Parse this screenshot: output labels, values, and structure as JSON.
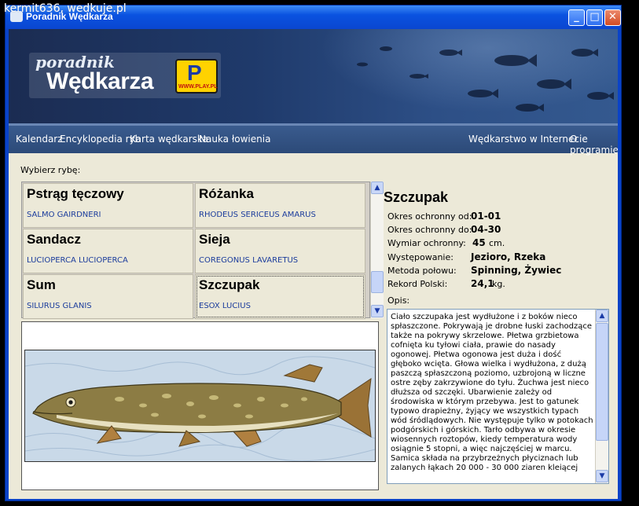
{
  "watermark": "kermit636, wedkuje.pl",
  "window": {
    "title": "Poradnik Wędkarza",
    "minimize": "_",
    "maximize": "□",
    "close": "✕"
  },
  "banner": {
    "logo_small": "poradnik",
    "logo_main": "Wędkarza",
    "play_letter": "P",
    "play_url": "WWW.PLAY.PL"
  },
  "menu": {
    "left": [
      "Kalendarz",
      "Encyklopedia ryb",
      "Karta wędkarska",
      "Nauka łowienia"
    ],
    "right": [
      "Wędkarstwo w Internecie",
      "O programie"
    ]
  },
  "chooser_label": "Wybierz rybę:",
  "fish_list": [
    {
      "name": "Pstrąg tęczowy",
      "latin": "SALMO GAIRDNERI"
    },
    {
      "name": "Różanka",
      "latin": "RHODEUS SERICEUS AMARUS"
    },
    {
      "name": "Sandacz",
      "latin": "LUCIOPERCA LUCIOPERCA"
    },
    {
      "name": "Sieja",
      "latin": "COREGONUS LAVARETUS"
    },
    {
      "name": "Sum",
      "latin": "SILURUS GLANIS"
    },
    {
      "name": "Szczupak",
      "latin": "ESOX LUCIUS"
    }
  ],
  "selected_fish": "Szczupak",
  "details": {
    "title": "Szczupak",
    "okres_od_label": "Okres ochronny od:",
    "okres_od": "01-01",
    "okres_do_label": "Okres ochronny do:",
    "okres_do": "04-30",
    "wymiar_label": "Wymiar ochronny:",
    "wymiar": "45",
    "wymiar_unit": "cm.",
    "wystepowanie_label": "Występowanie:",
    "wystepowanie": "Jezioro, Rzeka",
    "metoda_label": "Metoda połowu:",
    "metoda": "Spinning, Żywiec",
    "rekord_label": "Rekord Polski:",
    "rekord": "24,1",
    "rekord_unit": "kg.",
    "opis_label": "Opis:",
    "opis": "Ciało szczupaka jest wydłużone i z boków nieco spłaszczone. Pokrywają je drobne łuski zachodzące także na pokrywy skrzelowe. Płetwa grzbietowa cofnięta ku tyłowi ciała, prawie do nasady ogonowej. Płetwa ogonowa jest duża i dość głęboko wcięta. Głowa wielka i wydłużona, z dużą paszczą spłaszczoną poziomo, uzbrojoną w liczne ostre zęby zakrzywione do tyłu. Żuchwa jest nieco dłuższa od szczęki. Ubarwienie zależy od środowiska w którym przebywa. Jest to gatunek typowo drapieżny, żyjący we wszystkich typach wód śródlądowych. Nie występuje tylko w potokach podgórskich i górskich. Tarło odbywa w okresie wiosennych roztopów, kiedy temperatura wody osiągnie 5 stopni, a więc najczęściej w marcu. Samica składa na przybrzeżnych płyciznach lub zalanych łąkach 20 000 - 30 000 ziaren kleiącej"
  }
}
